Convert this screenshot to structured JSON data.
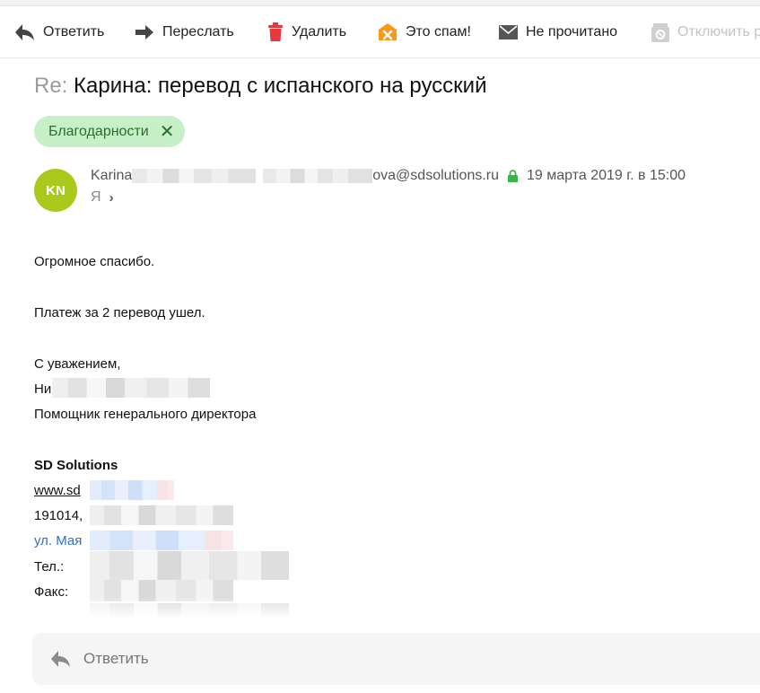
{
  "toolbar": {
    "reply": "Ответить",
    "forward": "Переслать",
    "delete": "Удалить",
    "spam": "Это спам!",
    "unread": "Не прочитано",
    "disable": "Отключить р"
  },
  "message": {
    "subject_prefix": "Re:",
    "subject": "Карина: перевод с испанского на русский",
    "label": "Благодарности",
    "avatar_initials": "KN",
    "sender_name_start": "Karina",
    "sender_email_end": "ova@sdsolutions.ru",
    "date": "19 марта 2019 г. в 15:00",
    "recipient": "Я"
  },
  "body": {
    "line1": "Огромное спасибо.",
    "line2": "Платеж за 2 перевод  ушел.",
    "regards": "С уважением,",
    "name_start": "Ни",
    "position": "Помощник генерального директора",
    "company": "SD Solutions",
    "website_start": "www.sd",
    "address_start": "191014,",
    "street_start": "ул. Мая",
    "phone_label": "Тел.:",
    "fax_label": "Факс:"
  },
  "reply_bar": {
    "label": "Ответить"
  },
  "colors": {
    "avatar": "#a9c91c",
    "label_bg": "#c8f0c8",
    "label_text": "#2a6c2a",
    "delete_icon": "#e8383d",
    "spam_icon": "#f59a1c",
    "secure_lock": "#3bb54a",
    "link_blue": "#2f6fcc"
  },
  "icons": {
    "reply": "reply-arrow-icon",
    "forward": "forward-arrow-icon",
    "delete": "trash-icon",
    "spam": "spam-icon",
    "unread": "envelope-icon",
    "disable": "disable-icon",
    "remove_label": "close-icon",
    "secure": "lock-icon",
    "expand": "chevron-right-icon"
  }
}
